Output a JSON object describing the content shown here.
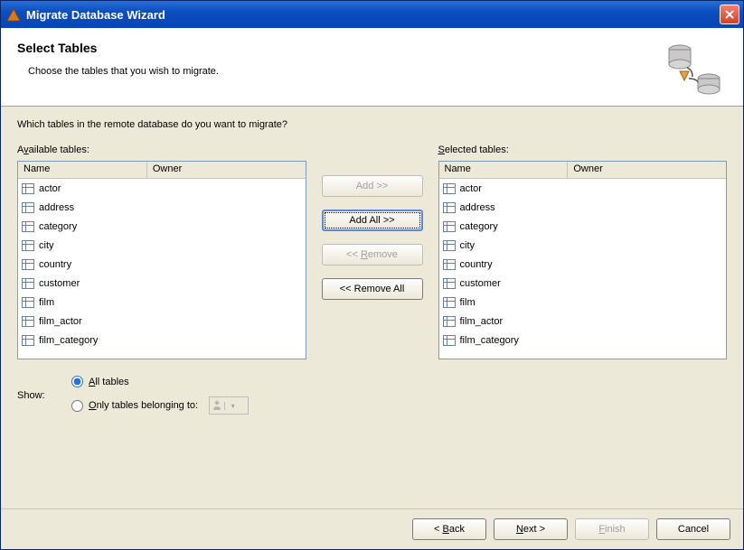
{
  "window": {
    "title": "Migrate Database Wizard"
  },
  "header": {
    "title": "Select Tables",
    "subtitle": "Choose the tables that you wish to migrate."
  },
  "prompt": "Which tables in the remote database do you want to migrate?",
  "availableLabel": "Available tables:",
  "selectedLabel": "Selected tables:",
  "columns": {
    "name": "Name",
    "owner": "Owner"
  },
  "available": [
    {
      "name": "actor",
      "owner": ""
    },
    {
      "name": "address",
      "owner": ""
    },
    {
      "name": "category",
      "owner": ""
    },
    {
      "name": "city",
      "owner": ""
    },
    {
      "name": "country",
      "owner": ""
    },
    {
      "name": "customer",
      "owner": ""
    },
    {
      "name": "film",
      "owner": ""
    },
    {
      "name": "film_actor",
      "owner": ""
    },
    {
      "name": "film_category",
      "owner": ""
    }
  ],
  "selected": [
    {
      "name": "actor",
      "owner": ""
    },
    {
      "name": "address",
      "owner": ""
    },
    {
      "name": "category",
      "owner": ""
    },
    {
      "name": "city",
      "owner": ""
    },
    {
      "name": "country",
      "owner": ""
    },
    {
      "name": "customer",
      "owner": ""
    },
    {
      "name": "film",
      "owner": ""
    },
    {
      "name": "film_actor",
      "owner": ""
    },
    {
      "name": "film_category",
      "owner": ""
    }
  ],
  "buttons": {
    "add": "Add >>",
    "addAll": "Add All >>",
    "remove": "<< Remove",
    "removeAll": "<< Remove All",
    "back": "< Back",
    "next": "Next >",
    "finish": "Finish",
    "cancel": "Cancel"
  },
  "show": {
    "label": "Show:",
    "all": "All tables",
    "only": "Only tables belonging to:",
    "selected": "all"
  }
}
